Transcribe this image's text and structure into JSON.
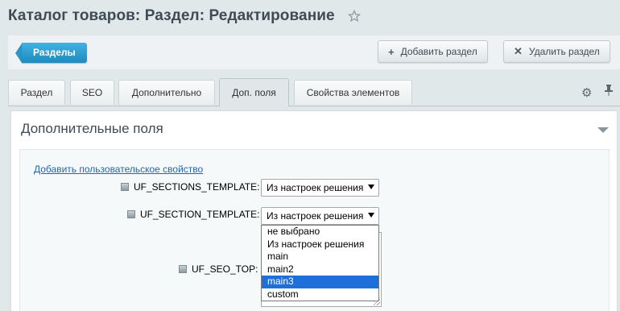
{
  "page": {
    "title": "Каталог товаров: Раздел: Редактирование"
  },
  "toolbar": {
    "back_label": "Разделы",
    "add_label": "Добавить раздел",
    "delete_label": "Удалить раздел"
  },
  "tabs": [
    {
      "label": "Раздел"
    },
    {
      "label": "SEO"
    },
    {
      "label": "Дополнительно"
    },
    {
      "label": "Доп. поля",
      "active": true
    },
    {
      "label": "Свойства элементов"
    }
  ],
  "section": {
    "title": "Дополнительные поля",
    "add_property_link": "Добавить пользовательское свойство"
  },
  "fields": [
    {
      "label": "UF_SECTIONS_TEMPLATE:",
      "value": "Из настроек решения"
    },
    {
      "label": "UF_SECTION_TEMPLATE:",
      "value": "Из настроек решения"
    },
    {
      "label": "UF_SEO_TOP:"
    }
  ],
  "dropdown": {
    "options": [
      "не выбрано",
      "Из настроек решения",
      "main",
      "main2",
      "main3",
      "custom"
    ],
    "highlighted": "main3"
  },
  "icons": {
    "star": "star-icon",
    "add": "plus-icon",
    "delete": "close-icon",
    "settings": "gear-icon",
    "pin": "pin-icon",
    "collapse": "chevron-down-icon",
    "help": "help-icon"
  },
  "colors": {
    "accent": "#1f8bbd",
    "link": "#2067b0",
    "selection": "#1e6fd9"
  }
}
